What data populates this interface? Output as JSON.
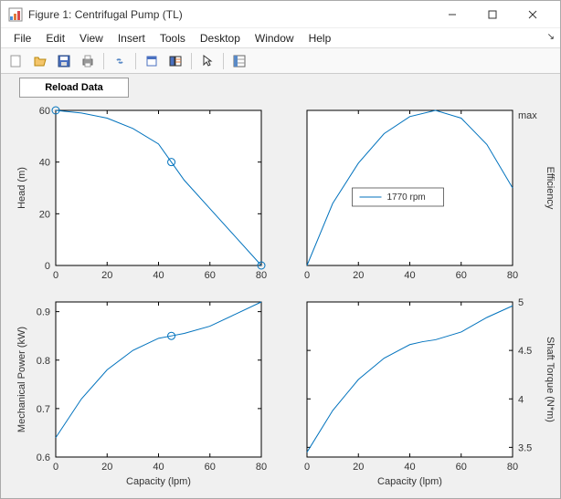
{
  "window": {
    "title": "Figure 1: Centrifugal Pump (TL)"
  },
  "menu": {
    "file": "File",
    "edit": "Edit",
    "view": "View",
    "insert": "Insert",
    "tools": "Tools",
    "desktop": "Desktop",
    "window": "Window",
    "help": "Help"
  },
  "reload_label": "Reload Data",
  "legend_label": "1770 rpm",
  "axes": {
    "tl": {
      "ylabel": "Head (m)",
      "xlabel": ""
    },
    "tr": {
      "ylabel": "Efficiency",
      "xlabel": "",
      "ytick_max": "max"
    },
    "bl": {
      "ylabel": "Mechanical Power (kW)",
      "xlabel": "Capacity (lpm)"
    },
    "br": {
      "ylabel": "Shaft Torque (N*m)",
      "xlabel": "Capacity (lpm)"
    }
  },
  "ticks": {
    "x_common": [
      "0",
      "20",
      "40",
      "60",
      "80"
    ],
    "tl_y": [
      "0",
      "20",
      "40",
      "60"
    ],
    "bl_y": [
      "0.6",
      "0.7",
      "0.8",
      "0.9"
    ],
    "br_y": [
      "3.5",
      "4",
      "4.5",
      "5"
    ]
  },
  "chart_data": [
    {
      "type": "line",
      "position": "top-left",
      "title": "",
      "xlabel": "Capacity (lpm)",
      "ylabel": "Head (m)",
      "x": [
        0,
        10,
        20,
        30,
        40,
        45,
        50,
        60,
        70,
        80
      ],
      "y": [
        60,
        59,
        57,
        53,
        47,
        40,
        33,
        22,
        11,
        0
      ],
      "markers_x": [
        0,
        45,
        80
      ],
      "markers_y": [
        60,
        40,
        0
      ],
      "xlim": [
        0,
        80
      ],
      "ylim": [
        0,
        60
      ]
    },
    {
      "type": "line",
      "position": "top-right",
      "title": "",
      "xlabel": "Capacity (lpm)",
      "ylabel": "Efficiency",
      "x": [
        0,
        10,
        20,
        30,
        40,
        50,
        60,
        70,
        80
      ],
      "y": [
        0.0,
        0.4,
        0.66,
        0.85,
        0.96,
        1.0,
        0.95,
        0.78,
        0.5
      ],
      "xlim": [
        0,
        80
      ],
      "ylim": [
        0,
        1
      ],
      "legend": "1770 rpm",
      "y_tick_label_only": "max"
    },
    {
      "type": "line",
      "position": "bottom-left",
      "title": "",
      "xlabel": "Capacity (lpm)",
      "ylabel": "Mechanical Power (kW)",
      "x": [
        0,
        10,
        20,
        30,
        40,
        45,
        50,
        60,
        70,
        80
      ],
      "y": [
        0.64,
        0.72,
        0.78,
        0.82,
        0.845,
        0.85,
        0.855,
        0.87,
        0.895,
        0.92
      ],
      "markers_x": [
        45
      ],
      "markers_y": [
        0.85
      ],
      "xlim": [
        0,
        80
      ],
      "ylim": [
        0.6,
        0.92
      ]
    },
    {
      "type": "line",
      "position": "bottom-right",
      "title": "",
      "xlabel": "Capacity (lpm)",
      "ylabel": "Shaft Torque (N*m)",
      "x": [
        0,
        10,
        20,
        30,
        40,
        45,
        50,
        60,
        70,
        80
      ],
      "y": [
        3.45,
        3.88,
        4.2,
        4.42,
        4.56,
        4.59,
        4.61,
        4.69,
        4.84,
        4.96
      ],
      "xlim": [
        0,
        80
      ],
      "ylim": [
        3.4,
        5.0
      ]
    }
  ]
}
